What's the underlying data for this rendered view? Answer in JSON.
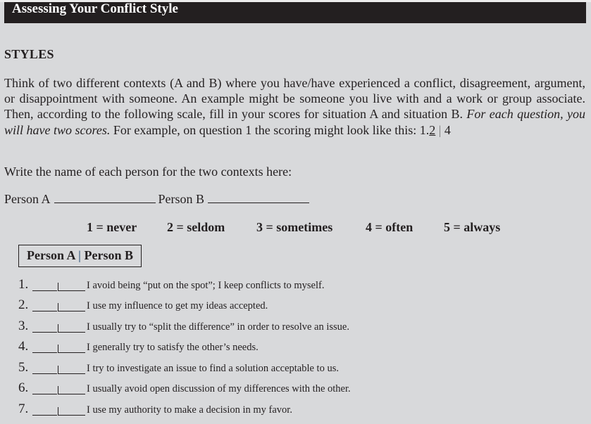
{
  "document": {
    "title": "Assessing Your Conflict Style",
    "section_heading": "STYLES",
    "intro": {
      "part1": "Think of two different contexts (A and B) where you have/have experienced a conflict, disagreement, argument, or disappointment with someone. An example might be someone you live with and a work or group associate. Then, according to the following scale, fill in your scores for situation A and situation B. ",
      "italic": "For each question, you will have two scores.",
      "part2": " For example, on question 1 the scoring might look like this: ",
      "example": {
        "prefix": "1.",
        "score_a": "2",
        "separator": "|",
        "score_b": "4"
      }
    },
    "write_names_prompt": "Write the name of each person for the two contexts here:",
    "person_a_label": "Person A",
    "person_b_label": "Person B",
    "scale": [
      "1 = never",
      "2 = seldom",
      "3 = sometimes",
      "4 = often",
      "5 = always"
    ],
    "column_header": {
      "person_a": "Person A",
      "separator": "|",
      "person_b": "Person B"
    },
    "questions": [
      {
        "number": "1.",
        "text": "I avoid being “put on the spot”; I keep conflicts to myself."
      },
      {
        "number": "2.",
        "text": "I use my influence to get my ideas accepted."
      },
      {
        "number": "3.",
        "text": "I usually try to “split the difference” in order to resolve an issue."
      },
      {
        "number": "4.",
        "text": "I generally try to satisfy the other’s needs."
      },
      {
        "number": "5.",
        "text": "I try to investigate an issue to find a solution acceptable to us."
      },
      {
        "number": "6.",
        "text": "I usually avoid open discussion of my differences with the other."
      },
      {
        "number": "7.",
        "text": "I use my authority to make a decision in my favor."
      }
    ]
  }
}
